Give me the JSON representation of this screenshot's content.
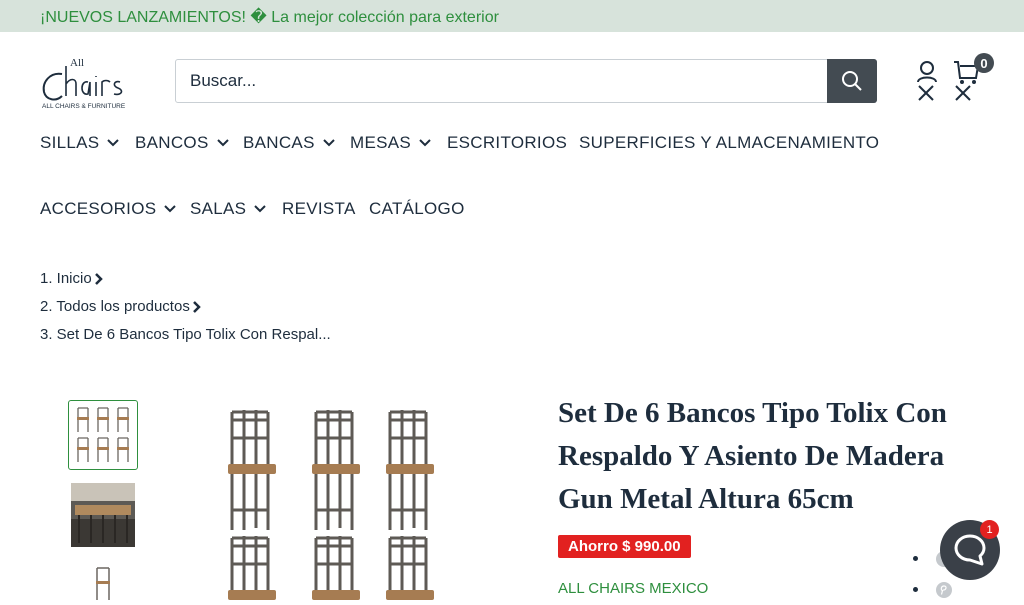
{
  "announcement": {
    "text": "¡NUEVOS LANZAMIENTOS! � La mejor colección para exterior"
  },
  "header": {
    "logo_text": "All Chairs",
    "logo_subtext": "ALL CHAIRS & FURNITURE",
    "search_placeholder": "Buscar...",
    "cart_count": "0"
  },
  "nav": {
    "items": [
      {
        "label": "SILLAS",
        "has_dropdown": true
      },
      {
        "label": "BANCOS",
        "has_dropdown": true
      },
      {
        "label": "BANCAS",
        "has_dropdown": true
      },
      {
        "label": "MESAS",
        "has_dropdown": true
      },
      {
        "label": "ESCRITORIOS",
        "has_dropdown": false
      },
      {
        "label": "SUPERFICIES Y ALMACENAMIENTO",
        "has_dropdown": false
      },
      {
        "label": "ACCESORIOS",
        "has_dropdown": true
      },
      {
        "label": "SALAS",
        "has_dropdown": true
      },
      {
        "label": "REVISTA",
        "has_dropdown": false
      },
      {
        "label": "CATÁLOGO",
        "has_dropdown": false
      }
    ]
  },
  "breadcrumb": [
    {
      "label": "1. Inicio"
    },
    {
      "label": "2. Todos los productos"
    },
    {
      "label": "3. Set De 6 Bancos Tipo Tolix Con Respal..."
    }
  ],
  "product": {
    "title": "Set De 6 Bancos Tipo Tolix Con Respaldo Y Asiento De Madera Gun Metal Altura 65cm",
    "savings": "Ahorro $ 990.00",
    "vendor": "ALL CHAIRS MEXICO"
  },
  "chat": {
    "unread": "1"
  },
  "colors": {
    "accent": "#2e8f3e",
    "announcement_bg": "#d7e3db",
    "header_button": "#434b52",
    "sale_badge": "#e22120",
    "text": "#1e2d3d"
  }
}
